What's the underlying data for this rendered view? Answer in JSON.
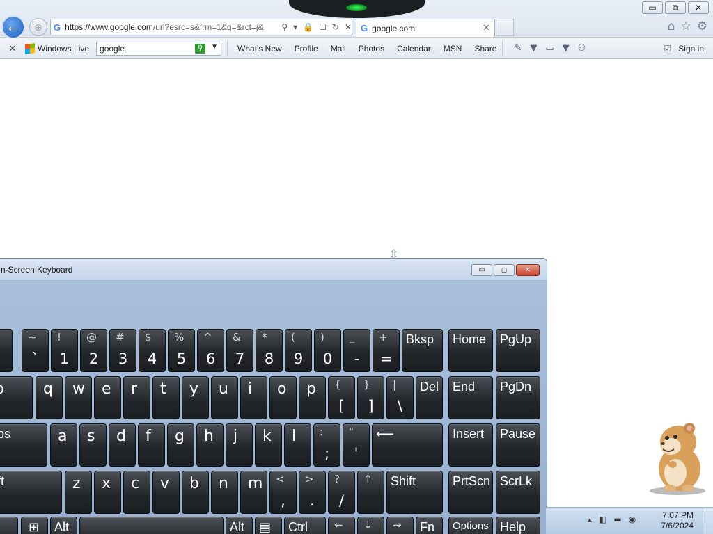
{
  "window": {
    "minimize": "▭",
    "restore": "⧉",
    "close": "✕"
  },
  "nav": {
    "back_glyph": "←",
    "forward_glyph": "⊕"
  },
  "address_bar": {
    "favicon": "G",
    "url_host": "https://www.google.com",
    "url_rest": "/url?esrc=s&frm=1&q=&rct=j&",
    "icons": [
      "⚲",
      "▾",
      "🔒",
      "☐",
      "↻",
      "✕"
    ]
  },
  "tab": {
    "favicon": "G",
    "title": "google.com",
    "close": "✕"
  },
  "tools": [
    "⌂",
    "☆",
    "⚙"
  ],
  "toolbar": {
    "close": "✕",
    "brand": "Windows Live",
    "search_value": "google",
    "search_go": "⚲",
    "search_dropdown": "▼",
    "links": [
      "What's New",
      "Profile",
      "Mail",
      "Photos",
      "Calendar",
      "MSN",
      "Share"
    ],
    "icons": [
      "✎",
      "▼",
      "▭",
      "▼",
      "⚇"
    ],
    "sign_in_icon": "☑",
    "sign_in": "Sign in"
  },
  "osk": {
    "title": "n-Screen Keyboard",
    "minimize": "▭",
    "maximize": "◻",
    "close": "✕",
    "keys": {
      "esc": "",
      "grave": {
        "shift": "~",
        "main": "`"
      },
      "k1": {
        "shift": "!",
        "main": "1"
      },
      "k2": {
        "shift": "@",
        "main": "2"
      },
      "k3": {
        "shift": "#",
        "main": "3"
      },
      "k4": {
        "shift": "$",
        "main": "4"
      },
      "k5": {
        "shift": "%",
        "main": "5"
      },
      "k6": {
        "shift": "^",
        "main": "6"
      },
      "k7": {
        "shift": "&",
        "main": "7"
      },
      "k8": {
        "shift": "*",
        "main": "8"
      },
      "k9": {
        "shift": "(",
        "main": "9"
      },
      "k0": {
        "shift": ")",
        "main": "0"
      },
      "minus": {
        "shift": "_",
        "main": "-"
      },
      "equals": {
        "shift": "+",
        "main": "="
      },
      "bksp": "Bksp",
      "home": "Home",
      "pgup": "PgUp",
      "tab": "p",
      "q": "q",
      "w": "w",
      "e": "e",
      "r": "r",
      "t": "t",
      "y": "y",
      "u": "u",
      "i": "i",
      "o": "o",
      "p": "p",
      "lbracket": {
        "shift": "{",
        "main": "["
      },
      "rbracket": {
        "shift": "}",
        "main": "]"
      },
      "backslash": {
        "shift": "|",
        "main": "\\"
      },
      "del": "Del",
      "end": "End",
      "pgdn": "PgDn",
      "caps": "ps",
      "a": "a",
      "s": "s",
      "d": "d",
      "f": "f",
      "g": "g",
      "h": "h",
      "j": "j",
      "k": "k",
      "l": "l",
      "semicolon": {
        "shift": ":",
        "main": ";"
      },
      "quote": {
        "shift": "\"",
        "main": "'"
      },
      "enter": "⟵",
      "insert": "Insert",
      "pause": "Pause",
      "lshift": "ft",
      "z": "z",
      "x": "x",
      "c": "c",
      "v": "v",
      "b": "b",
      "n": "n",
      "m": "m",
      "comma": {
        "shift": "<",
        "main": ","
      },
      "period": {
        "shift": ">",
        "main": "."
      },
      "slash": {
        "shift": "?",
        "main": "/"
      },
      "up": "↑",
      "rshift": "Shift",
      "prtscn": "PrtScn",
      "scrlk": "ScrLk",
      "fn_left": "",
      "win": "⊞",
      "alt_left": "Alt",
      "space": "",
      "alt_right": "Alt",
      "menu": "▤",
      "ctrl": "Ctrl",
      "left": "←",
      "down": "↓",
      "right": "→",
      "fn": "Fn",
      "options": "Options",
      "help": "Help"
    }
  },
  "taskbar": {
    "tray_icons": [
      "▴",
      "◧",
      "▬",
      "◉"
    ],
    "time": "7:07 PM",
    "date": "7/6/2024"
  }
}
